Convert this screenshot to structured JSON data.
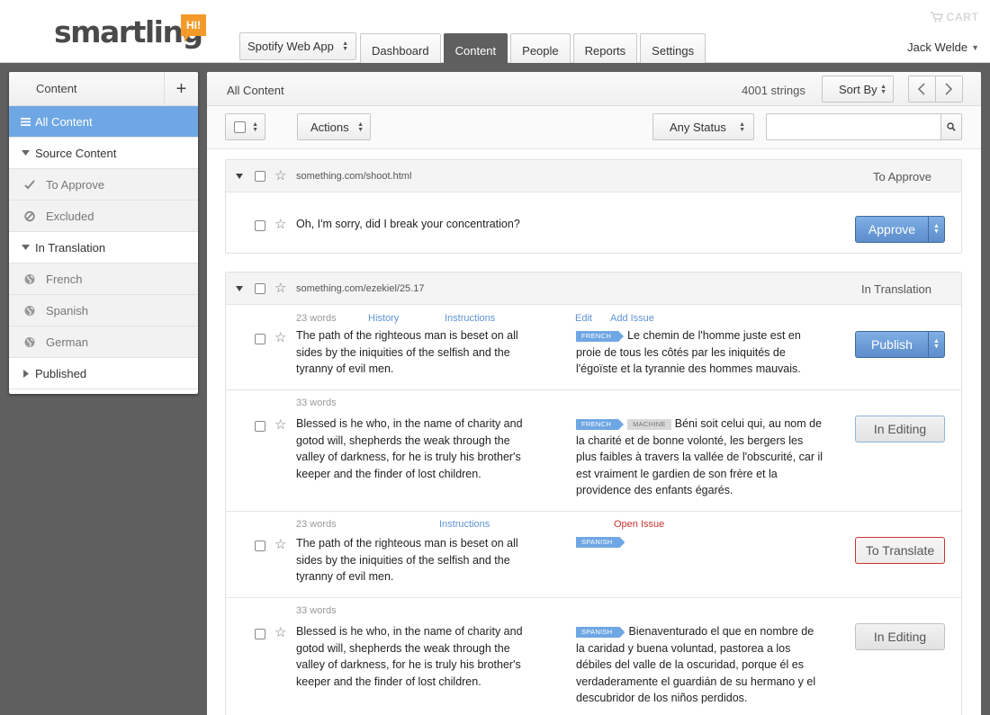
{
  "header": {
    "logo_text": "smartling",
    "logo_badge": "HI!",
    "cart_label": "CART",
    "user_name": "Jack Welde",
    "app_select": "Spotify Web App",
    "tabs": [
      {
        "label": "Dashboard",
        "active": false
      },
      {
        "label": "Content",
        "active": true
      },
      {
        "label": "People",
        "active": false
      },
      {
        "label": "Reports",
        "active": false
      },
      {
        "label": "Settings",
        "active": false
      }
    ]
  },
  "sidebar": {
    "title": "Content",
    "add_icon": "plus-icon",
    "items": [
      {
        "label": "All Content",
        "icon": "list-icon"
      },
      {
        "label": "Source Content",
        "icon": "triangle-down-icon"
      },
      {
        "label": "To Approve",
        "icon": "check-icon"
      },
      {
        "label": "Excluded",
        "icon": "ban-icon"
      },
      {
        "label": "In Translation",
        "icon": "triangle-down-icon"
      },
      {
        "label": "French",
        "icon": "globe-icon"
      },
      {
        "label": "Spanish",
        "icon": "globe-icon"
      },
      {
        "label": "German",
        "icon": "globe-icon"
      },
      {
        "label": "Published",
        "icon": "triangle-right-icon"
      }
    ]
  },
  "main": {
    "title": "All Content",
    "string_count": "4001 strings",
    "sort_label": "Sort By",
    "actions_label": "Actions",
    "status_filter": "Any Status",
    "search_placeholder": ""
  },
  "groups": [
    {
      "path": "something.com/shoot.html",
      "status": "To Approve",
      "rows": [
        {
          "source": "Oh, I'm sorry, did I break your concentration?",
          "action": "Approve"
        }
      ]
    },
    {
      "path": "something.com/ezekiel/25.17",
      "status": "In Translation",
      "rows": [
        {
          "words": "23 words",
          "links": [
            "History",
            "Instructions",
            "Edit",
            "Add Issue"
          ],
          "source": "The path of the righteous man is beset on all sides by the iniquities of the selfish and the tyranny of evil men.",
          "tags": [
            "FRENCH"
          ],
          "target": "Le chemin de l'homme juste est en proie de tous les côtés par les iniquités de l'égoïste et la tyrannie des hommes mauvais.",
          "action": "Publish"
        },
        {
          "words": "33 words",
          "source": "Blessed is he who, in the name of charity and gotod will, shepherds the weak through the valley of darkness, for he is truly his brother's keeper and the finder of lost children.",
          "tags": [
            "FRENCH",
            "MACHINE"
          ],
          "target": "Béni soit celui qui, au nom de la charité et de bonne volonté, les bergers les plus faibles à travers la vallée de l'obscurité, car il est vraiment le gardien de son frère et la providence des enfants égarés.",
          "action": "In Editing"
        },
        {
          "words": "23 words",
          "links": [
            "Instructions",
            "Open Issue"
          ],
          "source": "The path of the righteous man is beset on all sides by the iniquities of the selfish and the tyranny of evil men.",
          "tags": [
            "SPANISH"
          ],
          "target": "",
          "action": "To Translate"
        },
        {
          "words": "33 words",
          "source": "Blessed is he who, in the name of charity and gotod will, shepherds the weak through the valley of darkness, for he is truly his brother's keeper and the finder of lost children.",
          "tags": [
            "SPANISH"
          ],
          "target": "Bienaventurado el que en nombre de la caridad y buena voluntad, pastorea a los débiles del valle de la oscuridad, porque él es verdaderamente el guardián de su hermano y el descubridor de los niños perdidos.",
          "action": "In Editing"
        }
      ]
    }
  ],
  "colors": {
    "accent_blue": "#6fa7e4",
    "logo_orange": "#f39a2a",
    "issue_red": "#c9352f",
    "link_blue": "#5d93d4"
  }
}
